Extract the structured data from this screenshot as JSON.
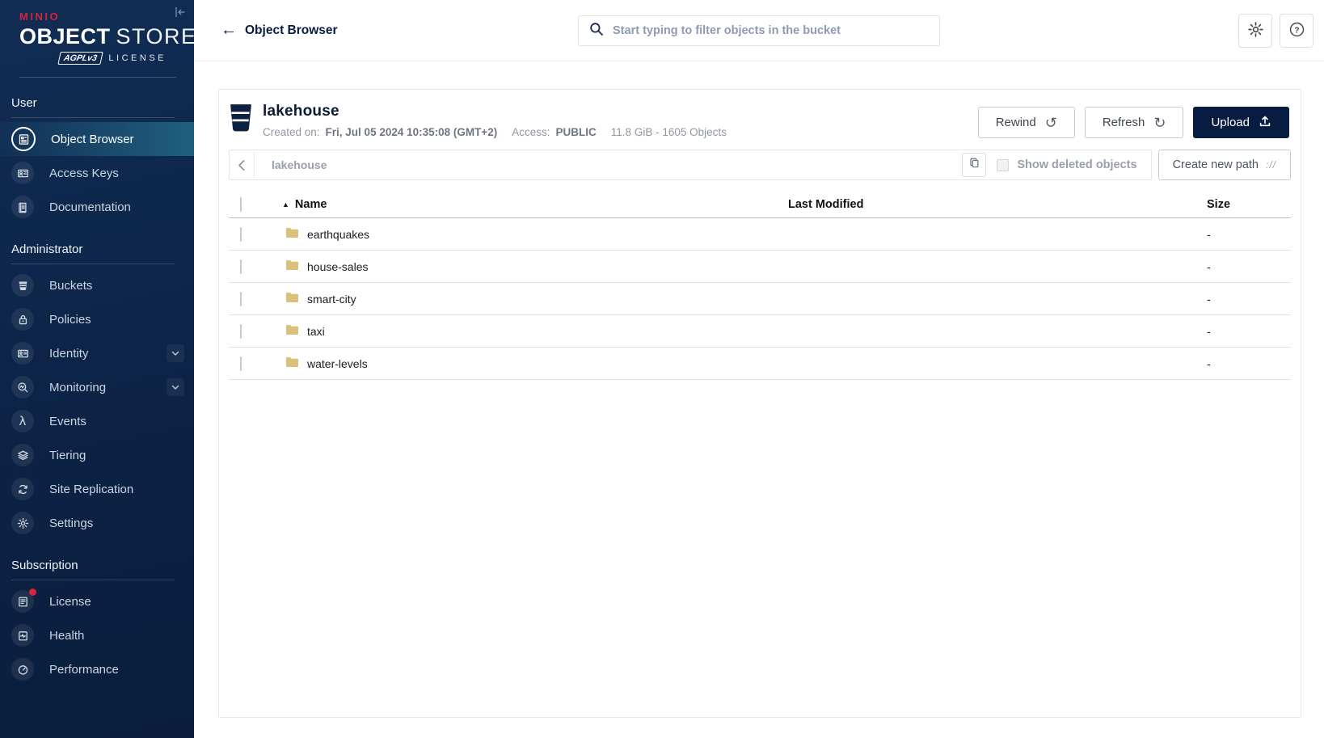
{
  "colors": {
    "brand_red": "#d0243f",
    "navy": "#081c42",
    "sidebar_top": "#112d54",
    "sidebar_bottom": "#0a1e3c",
    "selected_item_highlight": "#20607f",
    "folder": "#d9c07c"
  },
  "sidebar": {
    "brand": "MINIO",
    "product_bold": "OBJECT",
    "product_light": "STORE",
    "license_badge": "AGPLv3",
    "license_label": "LICENSE",
    "sections": [
      {
        "label": "User",
        "items": [
          {
            "label": "Object Browser",
            "icon": "object-browser",
            "active": true
          },
          {
            "label": "Access Keys",
            "icon": "access-keys"
          },
          {
            "label": "Documentation",
            "icon": "documentation"
          }
        ]
      },
      {
        "label": "Administrator",
        "items": [
          {
            "label": "Buckets",
            "icon": "buckets"
          },
          {
            "label": "Policies",
            "icon": "policies"
          },
          {
            "label": "Identity",
            "icon": "identity",
            "expandable": true
          },
          {
            "label": "Monitoring",
            "icon": "monitoring",
            "expandable": true
          },
          {
            "label": "Events",
            "icon": "events"
          },
          {
            "label": "Tiering",
            "icon": "tiering"
          },
          {
            "label": "Site Replication",
            "icon": "site-replication"
          },
          {
            "label": "Settings",
            "icon": "settings"
          }
        ]
      },
      {
        "label": "Subscription",
        "items": [
          {
            "label": "License",
            "icon": "license",
            "badge": true
          },
          {
            "label": "Health",
            "icon": "health"
          },
          {
            "label": "Performance",
            "icon": "performance"
          }
        ]
      }
    ]
  },
  "topbar": {
    "title": "Object Browser",
    "search": {
      "placeholder": "Start typing to filter objects in the bucket",
      "value": ""
    }
  },
  "bucket_header": {
    "name": "lakehouse",
    "created_label": "Created on:",
    "created_value": "Fri, Jul 05 2024 10:35:08 (GMT+2)",
    "access_label": "Access:",
    "access_value": "PUBLIC",
    "usage": "11.8 GiB - 1605 Objects",
    "buttons": {
      "rewind": "Rewind",
      "refresh": "Refresh",
      "upload": "Upload"
    }
  },
  "pathbar": {
    "current_path": "lakehouse",
    "show_deleted_label": "Show deleted objects",
    "show_deleted_checked": false,
    "create_path_label": "Create new path",
    "create_path_icon_text": "://"
  },
  "objects_table": {
    "columns": [
      "Name",
      "Last Modified",
      "Size"
    ],
    "sort_glyph": "▲",
    "rows": [
      {
        "name": "earthquakes",
        "type": "folder",
        "last_modified": "",
        "size": "-"
      },
      {
        "name": "house-sales",
        "type": "folder",
        "last_modified": "",
        "size": "-"
      },
      {
        "name": "smart-city",
        "type": "folder",
        "last_modified": "",
        "size": "-"
      },
      {
        "name": "taxi",
        "type": "folder",
        "last_modified": "",
        "size": "-"
      },
      {
        "name": "water-levels",
        "type": "folder",
        "last_modified": "",
        "size": "-"
      }
    ]
  }
}
